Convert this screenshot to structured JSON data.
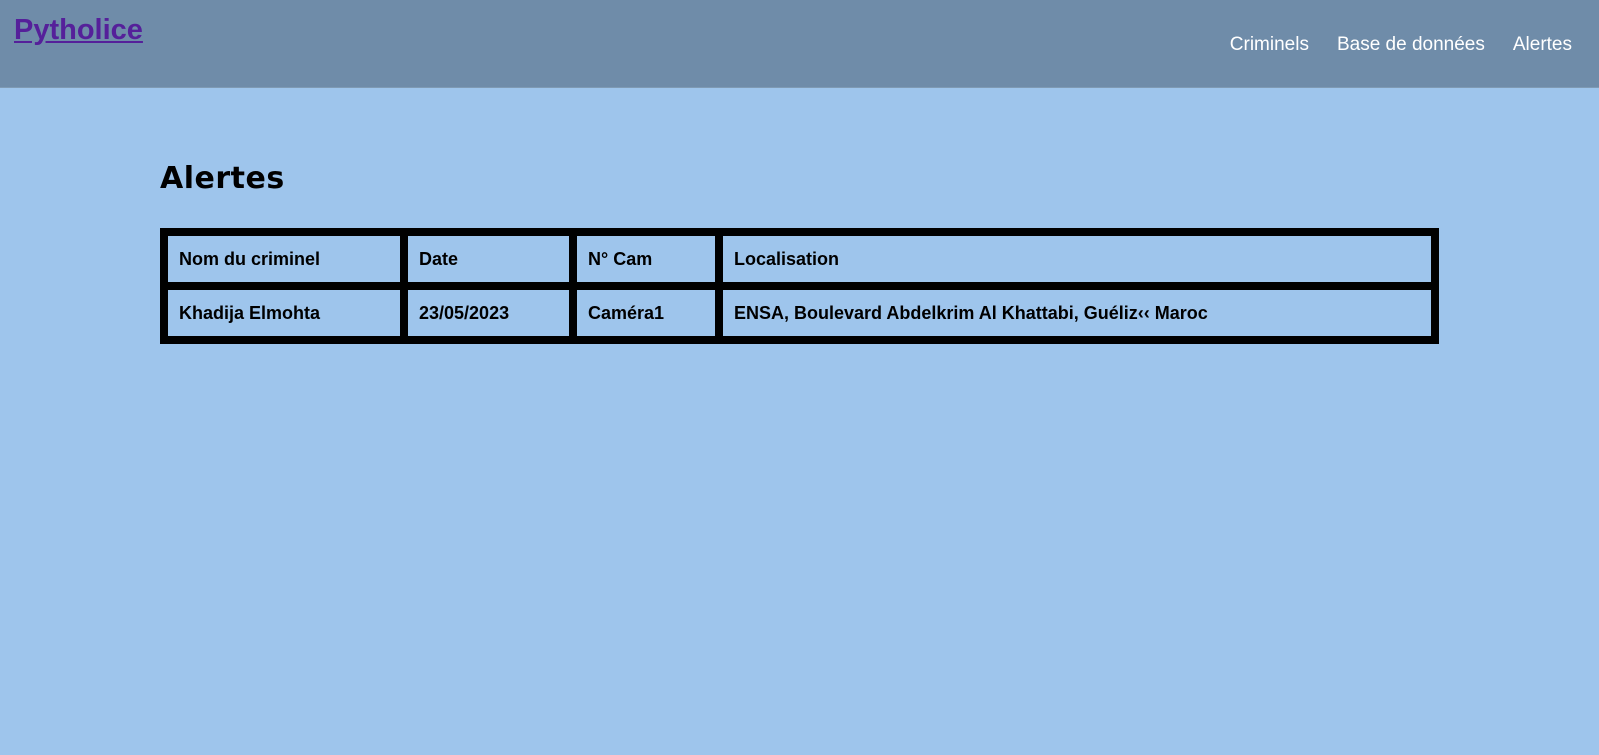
{
  "navbar": {
    "brand": "Pytholice",
    "links": [
      {
        "label": "Criminels"
      },
      {
        "label": "Base de données"
      },
      {
        "label": "Alertes"
      }
    ]
  },
  "main": {
    "title": "Alertes",
    "table": {
      "headers": [
        "Nom du criminel",
        "Date",
        "N° Cam",
        "Localisation"
      ],
      "rows": [
        [
          "Khadija Elmohta",
          "23/05/2023",
          "Caméra1",
          "ENSA, Boulevard Abdelkrim Al Khattabi, Guéliz‹‹ Maroc"
        ]
      ]
    }
  },
  "colors": {
    "background": "#9ec5ec",
    "navbar": "#6f8ca9",
    "brand": "#55209a",
    "table_border": "#000000"
  }
}
